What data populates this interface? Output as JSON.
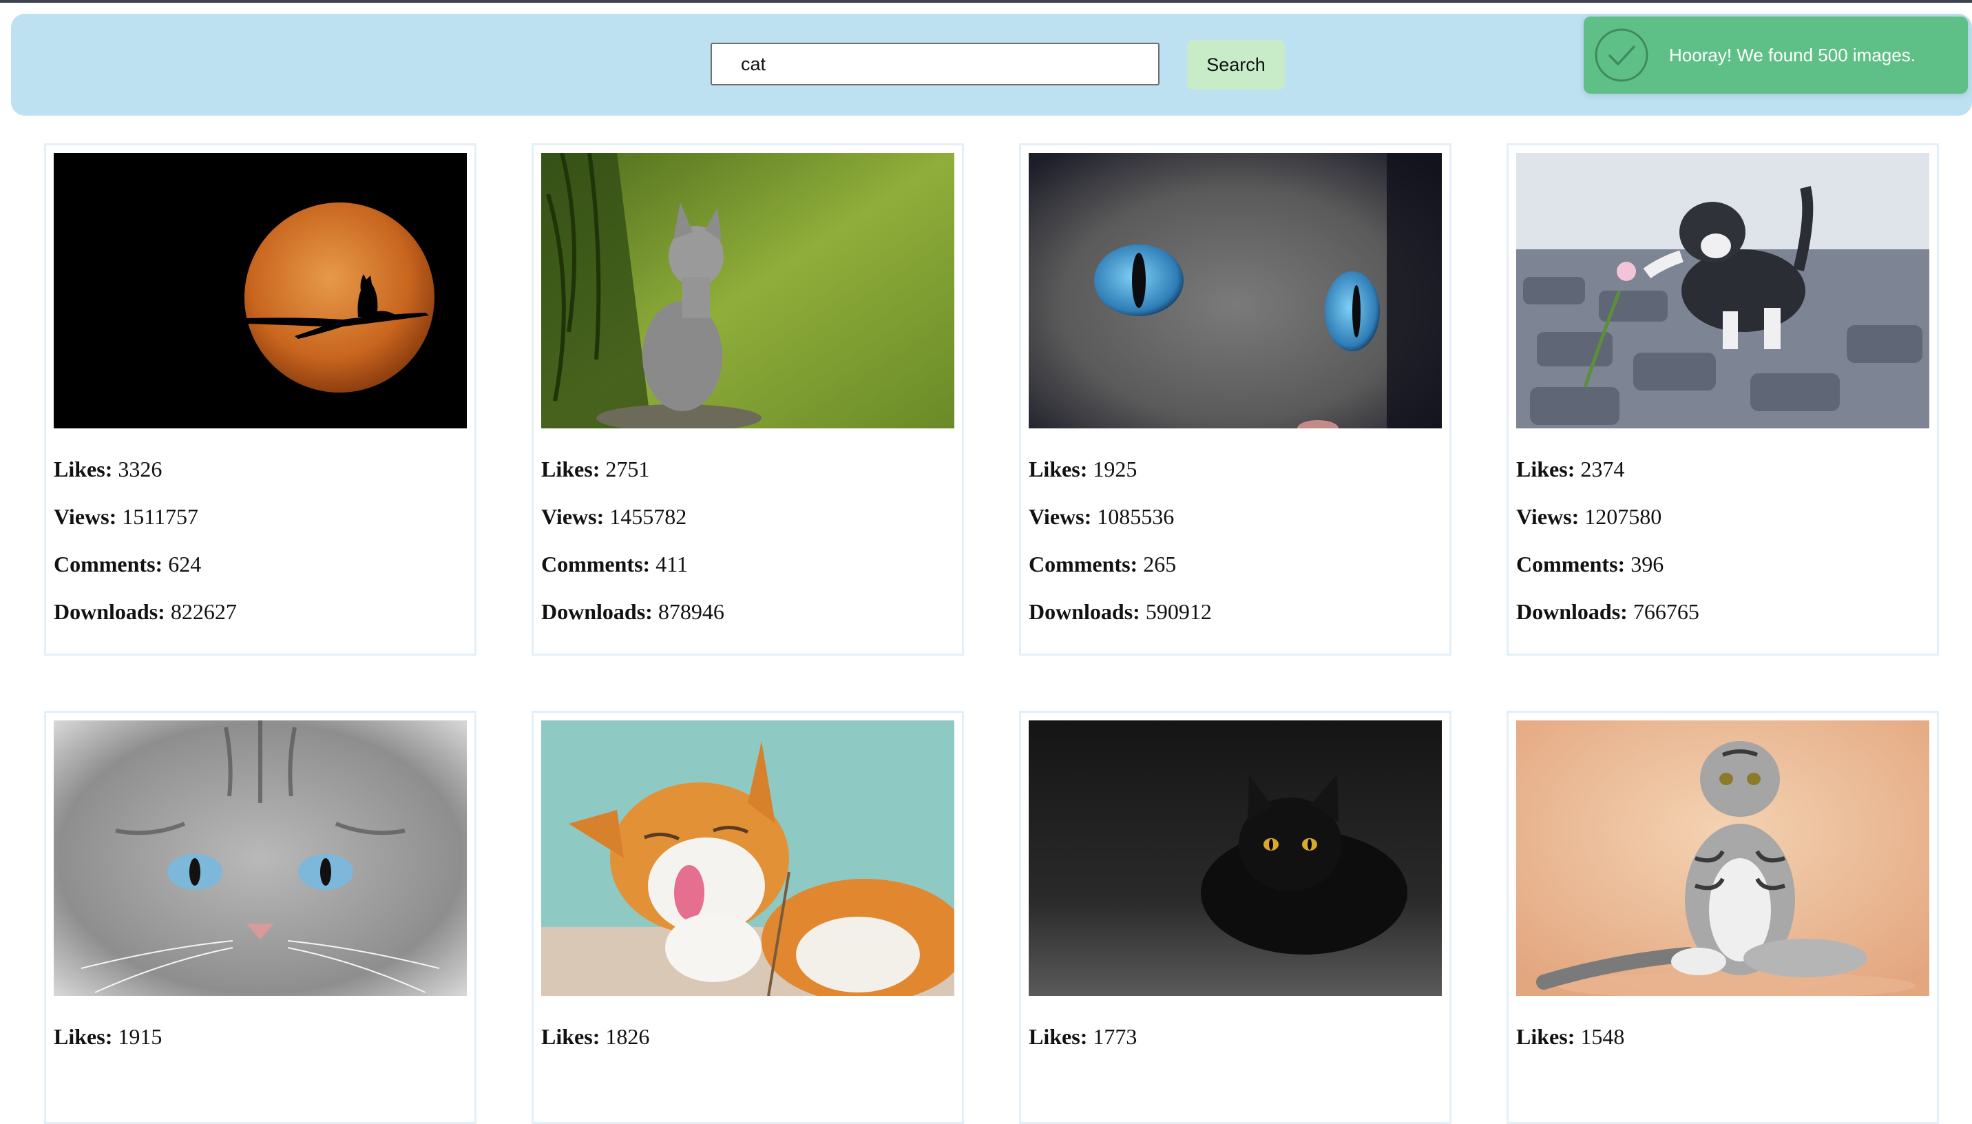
{
  "header": {
    "search_value": "cat",
    "search_button_label": "Search",
    "accent_color": "#bde1f1",
    "button_color": "#c8ecc8"
  },
  "toast": {
    "message": "Hooray! We found 500 images.",
    "icon": "check-circle-icon",
    "color": "#5ec087"
  },
  "stat_labels": {
    "likes": "Likes:",
    "views": "Views:",
    "comments": "Comments:",
    "downloads": "Downloads:"
  },
  "cards": [
    {
      "likes": "3326",
      "views": "1511757",
      "comments": "624",
      "downloads": "822627",
      "image": "cat-silhouette-moon"
    },
    {
      "likes": "2751",
      "views": "1455782",
      "comments": "411",
      "downloads": "878946",
      "image": "grey-kitten-in-forest"
    },
    {
      "likes": "1925",
      "views": "1085536",
      "comments": "265",
      "downloads": "590912",
      "image": "cat-blue-eyes-closeup"
    },
    {
      "likes": "2374",
      "views": "1207580",
      "comments": "396",
      "downloads": "766765",
      "image": "kitten-with-flower"
    },
    {
      "likes": "1915",
      "image": "grey-cat-face"
    },
    {
      "likes": "1826",
      "image": "orange-cat-licking"
    },
    {
      "likes": "1773",
      "image": "black-cat-dark"
    },
    {
      "likes": "1548",
      "image": "scottish-fold-sitting"
    }
  ]
}
